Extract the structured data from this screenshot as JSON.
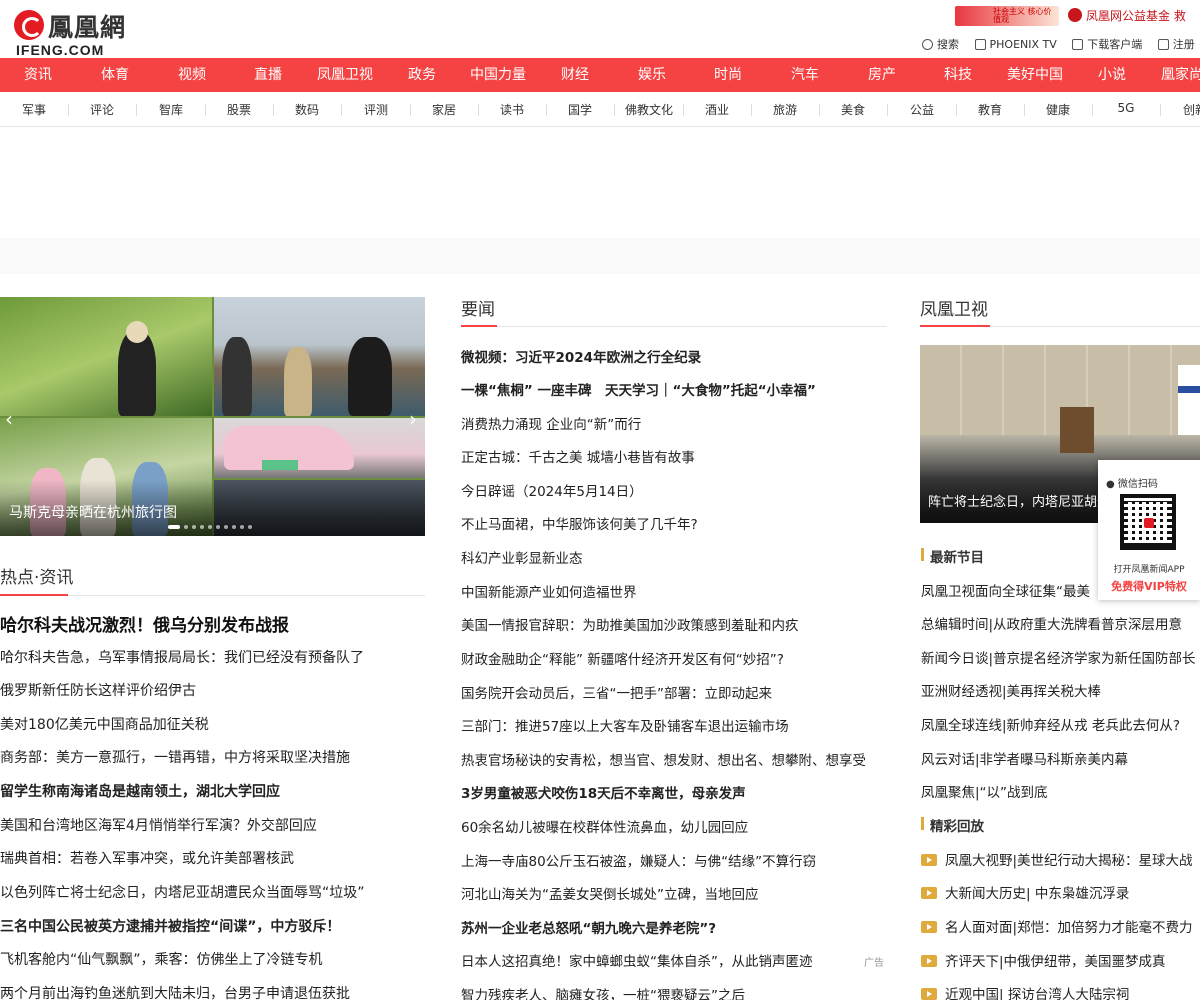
{
  "header": {
    "logo_cn": "鳳凰網",
    "logo_en": "IFENG.COM",
    "promo_badge": "社会主义 核心价值观",
    "charity": "凤凰网公益基金",
    "charity_tail": "救",
    "links": [
      {
        "icon": "search-icon",
        "label": "搜索"
      },
      {
        "icon": "tv-icon",
        "label": "PHOENIX TV"
      },
      {
        "icon": "download-icon",
        "label": "下载客户端"
      },
      {
        "icon": "edit-icon",
        "label": "注册"
      }
    ]
  },
  "nav": [
    "资讯",
    "体育",
    "视频",
    "直播",
    "凤凰卫视",
    "政务",
    "中国力量",
    "财经",
    "娱乐",
    "时尚",
    "汽车",
    "房产",
    "科技",
    "美好中国",
    "小说",
    "凰家尚"
  ],
  "subnav": [
    "军事",
    "评论",
    "智库",
    "股票",
    "数码",
    "评测",
    "家居",
    "读书",
    "国学",
    "佛教文化",
    "酒业",
    "旅游",
    "美食",
    "公益",
    "教育",
    "健康",
    "5G",
    "创新"
  ],
  "slider": {
    "caption": "马斯克母亲晒在杭州旅行图",
    "prev": "‹",
    "next": "›",
    "dot_count": 10,
    "active_dot": 0
  },
  "hot": {
    "title": "热点·资讯",
    "items": [
      {
        "text": "哈尔科夫战况激烈！俄乌分别发布战报",
        "style": "headline"
      },
      {
        "text": "哈尔科夫告急，乌军事情报局局长：我们已经没有预备队了",
        "style": ""
      },
      {
        "text": "俄罗斯新任防长这样评价绍伊古",
        "style": ""
      },
      {
        "text": "美对180亿美元中国商品加征关税",
        "style": ""
      },
      {
        "text": "商务部：美方一意孤行，一错再错，中方将采取坚决措施",
        "style": ""
      },
      {
        "text": "留学生称南海诸岛是越南领土，湖北大学回应",
        "style": "bold"
      },
      {
        "text": "美国和台湾地区海军4月悄悄举行军演？外交部回应",
        "style": ""
      },
      {
        "text": "瑞典首相：若卷入军事冲突，或允许美部署核武",
        "style": ""
      },
      {
        "text": "以色列阵亡将士纪念日，内塔尼亚胡遭民众当面辱骂“垃圾”",
        "style": ""
      },
      {
        "text": "三名中国公民被英方逮捕并被指控“间谍”，中方驳斥！",
        "style": "bold"
      },
      {
        "text": "飞机客舱内“仙气飘飘”，乘客：仿佛坐上了冷链专机",
        "style": ""
      },
      {
        "text": "两个月前出海钓鱼迷航到大陆未归，台男子申请退伍获批",
        "style": ""
      }
    ]
  },
  "news": {
    "title": "要闻",
    "items": [
      {
        "text": "微视频：习近平2024年欧洲之行全纪录",
        "style": "bold"
      },
      {
        "text": "一棵“焦桐” 一座丰碑　天天学习｜“大食物”托起“小幸福”",
        "style": "bold"
      },
      {
        "text": "消费热力涌现 企业向“新”而行",
        "style": ""
      },
      {
        "text": "正定古城：千古之美 城墙小巷皆有故事",
        "style": ""
      },
      {
        "text": "今日辟谣（2024年5月14日）",
        "style": ""
      },
      {
        "text": "不止马面裙，中华服饰该何美了几千年?",
        "style": ""
      },
      {
        "text": "科幻产业彰显新业态",
        "style": ""
      },
      {
        "text": "中国新能源产业如何造福世界",
        "style": ""
      },
      {
        "text": "美国一情报官辞职：为助推美国加沙政策感到羞耻和内疚",
        "style": ""
      },
      {
        "text": "财政金融助企“释能” 新疆喀什经济开发区有何“妙招”?",
        "style": ""
      },
      {
        "text": "国务院开会动员后，三省“一把手”部署：立即动起来",
        "style": ""
      },
      {
        "text": "三部门：推进57座以上大客车及卧铺客车退出运输市场",
        "style": ""
      },
      {
        "text": "热衷官场秘诀的安青松，想当官、想发财、想出名、想攀附、想享受",
        "style": ""
      },
      {
        "text": "3岁男童被恶犬咬伤18天后不幸离世，母亲发声",
        "style": "bold"
      },
      {
        "text": "60余名幼儿被曝在校群体性流鼻血，幼儿园回应",
        "style": ""
      },
      {
        "text": "上海一寺庙80公斤玉石被盗，嫌疑人：与佛“结缘”不算行窃",
        "style": ""
      },
      {
        "text": "河北山海关为“孟姜女哭倒长城处”立碑，当地回应",
        "style": ""
      },
      {
        "text": "苏州一企业老总怒吼“朝九晚六是养老院”?",
        "style": "bold"
      },
      {
        "text": "日本人这招真绝！家中蟑螂虫蚁“集体自杀”，从此销声匿迹",
        "style": ""
      },
      {
        "text": "智力残疾老人、脑瘫女孩，一桩“猥亵疑云”之后",
        "style": ""
      }
    ],
    "ad_tag": "广告"
  },
  "tv": {
    "title": "凤凰卫视",
    "image_caption": "阵亡将士纪念日，内塔尼亚胡遭民众当面辱骂",
    "latest_title": "最新节目",
    "latest": [
      "凤凰卫视面向全球征集“最美",
      "总编辑时间|从政府重大洗牌看普京深层用意",
      "新闻今日谈|普京提名经济学家为新任国防部长",
      "亚洲财经透视|美再挥关税大棒",
      "凤凰全球连线|新帅弃经从戎 老兵此去何从?",
      "风云对话|非学者曝马科斯亲美内幕",
      "凤凰聚焦|“以”战到底"
    ],
    "replay_title": "精彩回放",
    "replay": [
      "凤凰大视野|美世纪行动大揭秘：星球大战",
      "大新闻大历史| 中东枭雄沉浮录",
      "名人面对面|郑恺：加倍努力才能毫不费力",
      "齐评天下|中俄伊纽带，美国噩梦成真",
      "近观中国| 探访台湾人大陆宗祠"
    ]
  },
  "qr": {
    "label": "微信扫码",
    "line1": "打开凤凰新闻APP",
    "line2": "免费得VIP特权"
  },
  "colors": {
    "brand_red": "#f54343",
    "accent_gold": "#e0a93b"
  }
}
